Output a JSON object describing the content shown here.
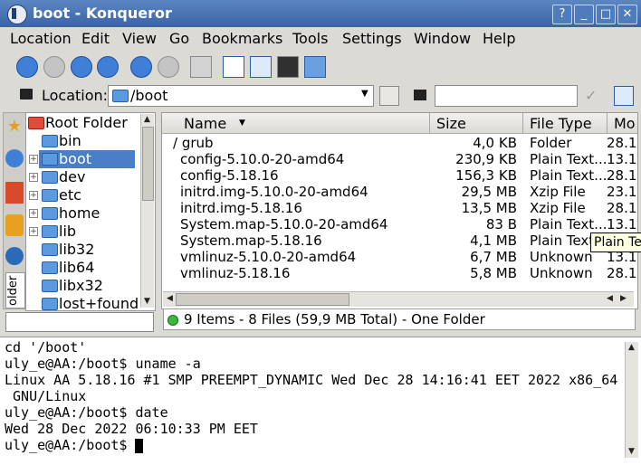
{
  "window": {
    "title": "boot - Konqueror",
    "help_btn": "?",
    "min_btn": "_",
    "max_btn": "□",
    "close_btn": "✕"
  },
  "menubar": [
    "Location",
    "Edit",
    "View",
    "Go",
    "Bookmarks",
    "Tools",
    "Settings",
    "Window",
    "Help"
  ],
  "toolbar": {
    "icons": [
      "back-icon",
      "forward-icon",
      "up-icon",
      "home-icon",
      "reload-icon",
      "stop-icon",
      "print-icon",
      "view-mode-icon",
      "split-view-icon",
      "terminal-icon",
      "show-panel-icon"
    ]
  },
  "location": {
    "label": "Location:",
    "value": "/boot",
    "search_value": ""
  },
  "tree": {
    "items": [
      {
        "label": "Root Folder",
        "expander": false,
        "selected": false,
        "red": true
      },
      {
        "label": "bin",
        "expander": false,
        "selected": false,
        "red": false
      },
      {
        "label": "boot",
        "expander": true,
        "selected": true,
        "red": false
      },
      {
        "label": "dev",
        "expander": true,
        "selected": false,
        "red": false
      },
      {
        "label": "etc",
        "expander": true,
        "selected": false,
        "red": false
      },
      {
        "label": "home",
        "expander": true,
        "selected": false,
        "red": false
      },
      {
        "label": "lib",
        "expander": true,
        "selected": false,
        "red": false
      },
      {
        "label": "lib32",
        "expander": false,
        "selected": false,
        "red": false
      },
      {
        "label": "lib64",
        "expander": false,
        "selected": false,
        "red": false
      },
      {
        "label": "libx32",
        "expander": false,
        "selected": false,
        "red": false
      },
      {
        "label": "lost+found",
        "expander": false,
        "selected": false,
        "red": false
      }
    ],
    "side_tab_label": "older"
  },
  "files": {
    "columns": [
      "Name",
      "Size",
      "File Type",
      "Mo"
    ],
    "rows": [
      {
        "name": "/ grub",
        "size": "4,0 KB",
        "type": "Folder",
        "mod": "28.1"
      },
      {
        "name": "config-5.10.0-20-amd64",
        "size": "230,9 KB",
        "type": "Plain Text...",
        "mod": "13.1"
      },
      {
        "name": "config-5.18.16",
        "size": "156,3 KB",
        "type": "Plain Text...",
        "mod": "28.1"
      },
      {
        "name": "initrd.img-5.10.0-20-amd64",
        "size": "29,5 MB",
        "type": "Xzip File",
        "mod": "23.1"
      },
      {
        "name": "initrd.img-5.18.16",
        "size": "13,5 MB",
        "type": "Xzip File",
        "mod": "28.1"
      },
      {
        "name": "System.map-5.10.0-20-amd64",
        "size": "83 B",
        "type": "Plain Text...",
        "mod": "13.1"
      },
      {
        "name": "System.map-5.18.16",
        "size": "4,1 MB",
        "type": "Plain Text",
        "mod": ""
      },
      {
        "name": "vmlinuz-5.10.0-20-amd64",
        "size": "6,7 MB",
        "type": "Unknown",
        "mod": "13.1"
      },
      {
        "name": "vmlinuz-5.18.16",
        "size": "5,8 MB",
        "type": "Unknown",
        "mod": "28.1"
      }
    ],
    "tooltip": "Plain Text"
  },
  "status": {
    "text": "9 Items - 8 Files (59,9 MB Total) - One Folder"
  },
  "terminal": {
    "lines": [
      "cd '/boot'",
      "uly_e@AA:/boot$ uname -a",
      "Linux AA 5.18.16 #1 SMP PREEMPT_DYNAMIC Wed Dec 28 14:16:41 EET 2022 x86_64",
      " GNU/Linux",
      "uly_e@AA:/boot$ date",
      "Wed 28 Dec 2022 06:10:33 PM EET",
      "uly_e@AA:/boot$ "
    ]
  }
}
